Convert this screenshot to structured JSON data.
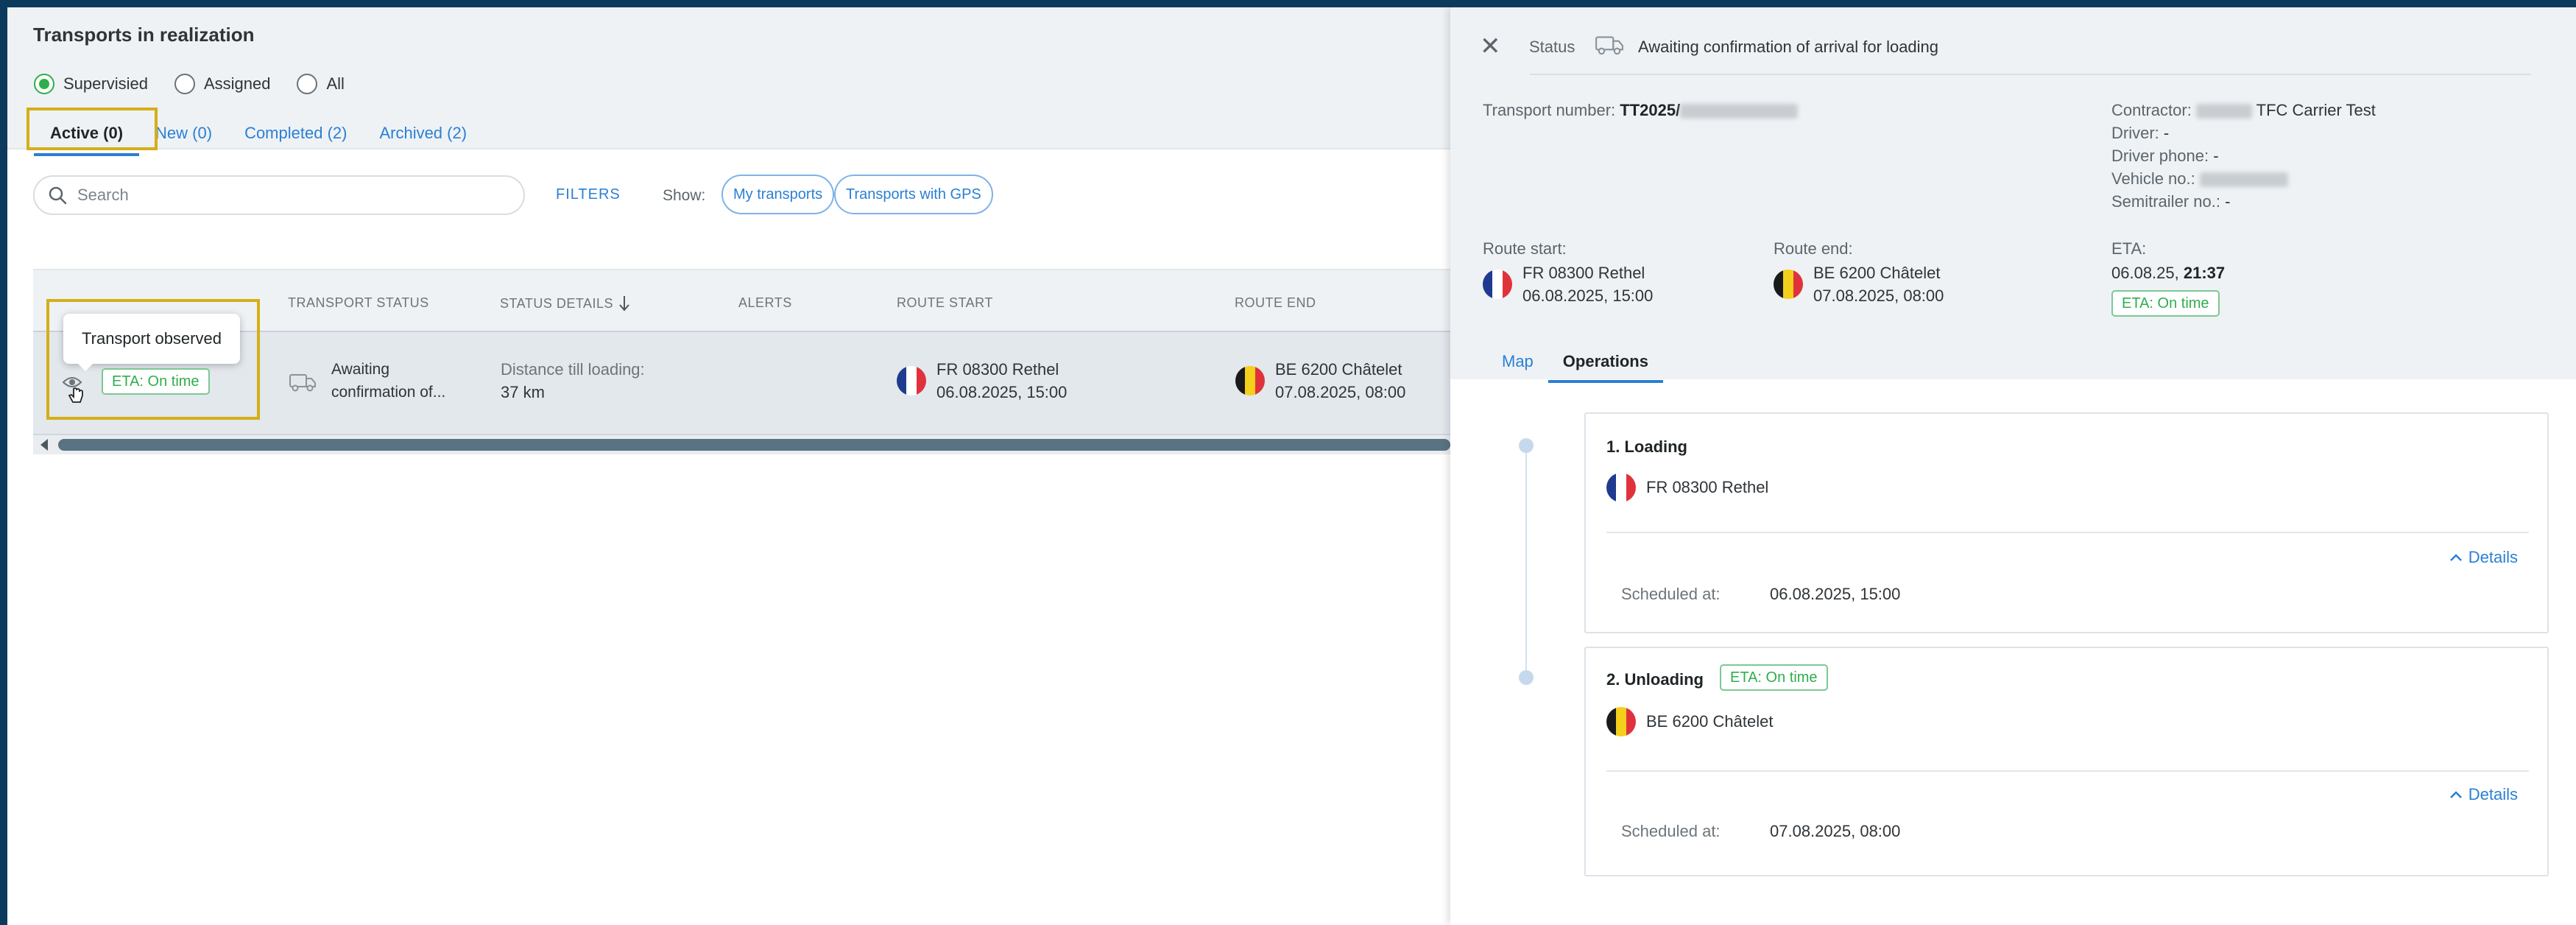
{
  "left": {
    "title": "Transports in realization",
    "radios": [
      {
        "label": "Supervisied",
        "selected": true
      },
      {
        "label": "Assigned",
        "selected": false
      },
      {
        "label": "All",
        "selected": false
      }
    ],
    "tabs": [
      "Active (0)",
      "New (0)",
      "Completed (2)",
      "Archived (2)"
    ],
    "search_placeholder": "Search",
    "filters": "FILTERS",
    "show_label": "Show:",
    "show_pills": [
      "My transports",
      "Transports with GPS"
    ],
    "columns": [
      "TRANSPORT STATUS",
      "STATUS DETAILS",
      "ALERTS",
      "ROUTE START",
      "ROUTE END"
    ],
    "row": {
      "tooltip": "Transport observed",
      "eta_badge": "ETA: On time",
      "status_line1": "Awaiting",
      "status_line2": "confirmation of...",
      "detail_label": "Distance till loading:",
      "detail_value": "37 km",
      "start_place": "FR 08300 Rethel",
      "start_date": "06.08.2025, 15:00",
      "end_place": "BE 6200 Châtelet",
      "end_date": "07.08.2025, 08:00"
    }
  },
  "right": {
    "status_label": "Status",
    "status_value": "Awaiting confirmation of arrival for loading",
    "transport_number_label": "Transport number:",
    "transport_number_prefix": "TT2025/",
    "contractor_label": "Contractor:",
    "contractor_value": "TFC Carrier Test",
    "driver_label": "Driver:",
    "driver_value": "-",
    "driver_phone_label": "Driver phone:",
    "driver_phone_value": "-",
    "vehicle_label": "Vehicle no.:",
    "semitrailer_label": "Semitrailer no.:",
    "semitrailer_value": "-",
    "route_start_label": "Route start:",
    "route_start_place": "FR 08300 Rethel",
    "route_start_date": "06.08.2025, 15:00",
    "route_end_label": "Route end:",
    "route_end_place": "BE 6200 Châtelet",
    "route_end_date": "07.08.2025, 08:00",
    "eta_label": "ETA:",
    "eta_date": "06.08.25,",
    "eta_time": "21:37",
    "eta_badge": "ETA: On time",
    "tabs": [
      "Map",
      "Operations"
    ],
    "operations": [
      {
        "title": "1. Loading",
        "place": "FR 08300 Rethel",
        "details": "Details",
        "scheduled_label": "Scheduled at:",
        "scheduled_value": "06.08.2025, 15:00"
      },
      {
        "title": "2. Unloading",
        "badge": "ETA: On time",
        "place": "BE 6200 Châtelet",
        "details": "Details",
        "scheduled_label": "Scheduled at:",
        "scheduled_value": "07.08.2025, 08:00"
      }
    ]
  },
  "colors": {
    "accent": "#2b7fd4",
    "success": "#2fae4c",
    "highlight": "#d5ae18",
    "background": "#eef2f5"
  }
}
